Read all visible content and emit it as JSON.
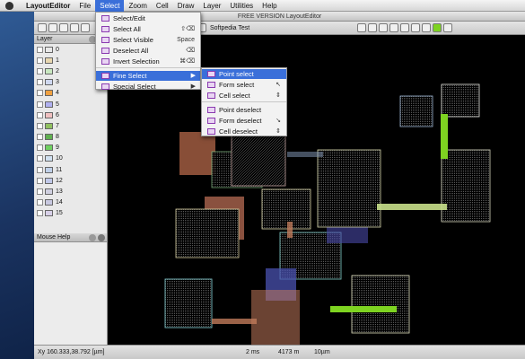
{
  "menubar": {
    "app": "LayoutEditor",
    "items": [
      "File",
      "Select",
      "Zoom",
      "Cell",
      "Draw",
      "Layer",
      "Utilities",
      "Help"
    ]
  },
  "window": {
    "title": "FREE VERSION LayoutEditor"
  },
  "toolbar": {
    "cell_name": "Softpedia Test"
  },
  "layer_panel": {
    "title": "Layer",
    "layers": [
      {
        "num": "0",
        "color": "#e8e8e8"
      },
      {
        "num": "1",
        "color": "#e8d7b0"
      },
      {
        "num": "2",
        "color": "#c9e8c0"
      },
      {
        "num": "3",
        "color": "#cfd8f0"
      },
      {
        "num": "4",
        "color": "#f0a040"
      },
      {
        "num": "5",
        "color": "#b0b0f0"
      },
      {
        "num": "6",
        "color": "#f0c0c0"
      },
      {
        "num": "7",
        "color": "#90c060"
      },
      {
        "num": "8",
        "color": "#60b050"
      },
      {
        "num": "9",
        "color": "#70d060"
      },
      {
        "num": "10",
        "color": "#d0e0f0"
      },
      {
        "num": "11",
        "color": "#c0d0e8"
      },
      {
        "num": "12",
        "color": "#c0c8e8"
      },
      {
        "num": "13",
        "color": "#d0d0e0"
      },
      {
        "num": "14",
        "color": "#c8c8e0"
      },
      {
        "num": "15",
        "color": "#d8d0e8"
      }
    ]
  },
  "help_panel": {
    "title": "Mouse Help"
  },
  "select_menu": {
    "items": [
      {
        "label": "Select/Edit",
        "shortcut": "",
        "submenu": false
      },
      {
        "label": "Select All",
        "shortcut": "⇧⌫",
        "submenu": false
      },
      {
        "label": "Select Visible",
        "shortcut": "Space",
        "submenu": false
      },
      {
        "label": "Deselect All",
        "shortcut": "⌫",
        "submenu": false
      },
      {
        "label": "Invert Selection",
        "shortcut": "⌘⌫",
        "submenu": false
      },
      {
        "label": "Fine Select",
        "shortcut": "",
        "submenu": true
      },
      {
        "label": "Special Select",
        "shortcut": "",
        "submenu": true
      }
    ]
  },
  "fine_select_menu": {
    "items": [
      {
        "label": "Point select",
        "shortcut": ""
      },
      {
        "label": "Form select",
        "shortcut": "↖"
      },
      {
        "label": "Cell select",
        "shortcut": "⇕"
      },
      {
        "label": "Point deselect",
        "shortcut": ""
      },
      {
        "label": "Form deselect",
        "shortcut": "↘"
      },
      {
        "label": "Cell deselect",
        "shortcut": "⇕"
      }
    ]
  },
  "statusbar": {
    "coords": "Xy 160.333,38.792 [µm]",
    "time": "2 ms",
    "zoom": "4173 m",
    "grid": "10µm"
  },
  "colors": {
    "menu_highlight": "#3a6fd9",
    "canvas_bg": "#000000",
    "green_wire": "#7ed321"
  }
}
